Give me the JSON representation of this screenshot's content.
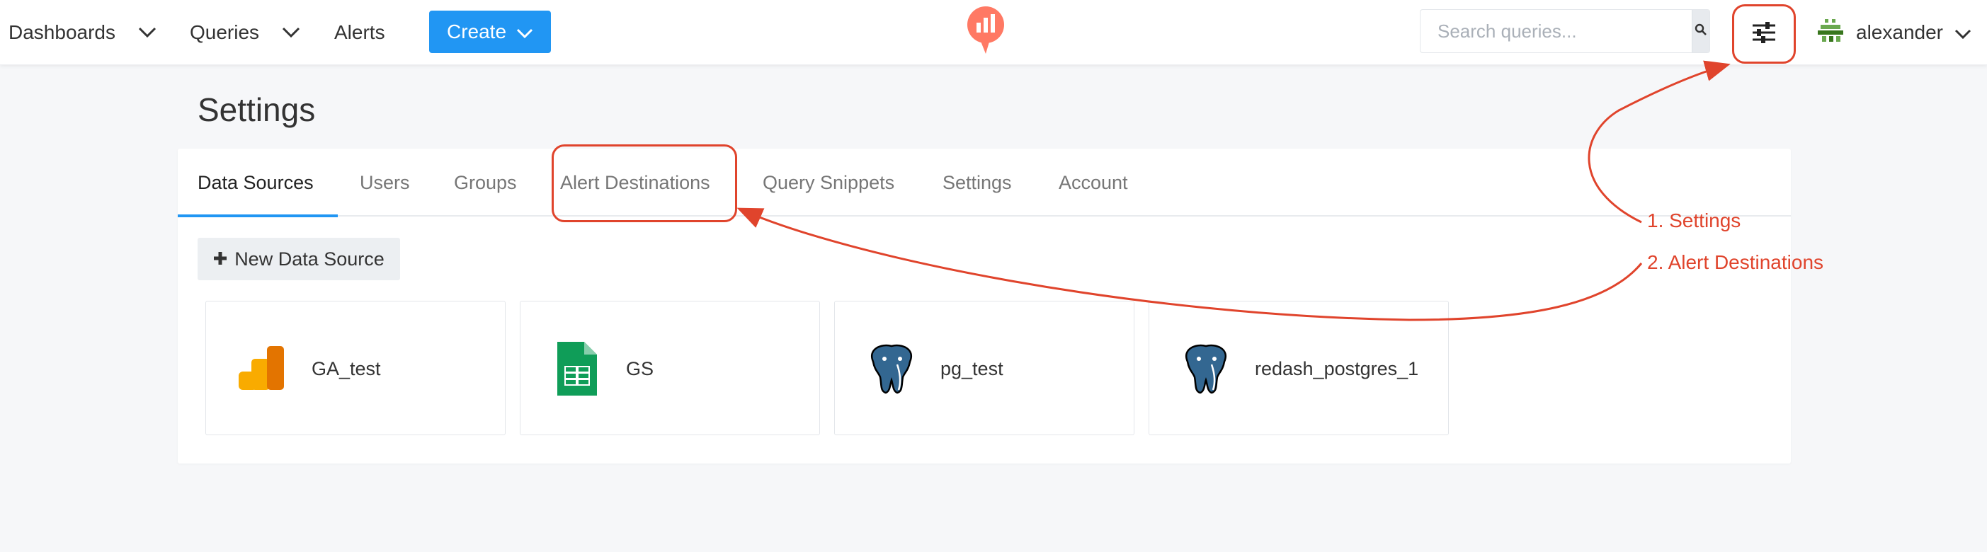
{
  "navbar": {
    "dashboards_label": "Dashboards",
    "queries_label": "Queries",
    "alerts_label": "Alerts",
    "create_label": "Create",
    "search_placeholder": "Search queries...",
    "user_name": "alexander"
  },
  "page": {
    "title": "Settings"
  },
  "tabs": [
    {
      "label": "Data Sources",
      "active": true
    },
    {
      "label": "Users",
      "active": false
    },
    {
      "label": "Groups",
      "active": false
    },
    {
      "label": "Alert Destinations",
      "active": false
    },
    {
      "label": "Query Snippets",
      "active": false
    },
    {
      "label": "Settings",
      "active": false
    },
    {
      "label": "Account",
      "active": false
    }
  ],
  "new_data_source_label": "New Data Source",
  "data_sources": [
    {
      "name": "GA_test",
      "icon": "google-analytics-icon"
    },
    {
      "name": "GS",
      "icon": "google-sheets-icon"
    },
    {
      "name": "pg_test",
      "icon": "postgresql-icon"
    },
    {
      "name": "redash_postgres_1",
      "icon": "postgresql-icon"
    }
  ],
  "annotations": {
    "step1": "1. Settings",
    "step2": "2. Alert Destinations"
  },
  "colors": {
    "primary": "#2196f3",
    "annotation": "#e0442c",
    "logo": "#ff7964"
  }
}
